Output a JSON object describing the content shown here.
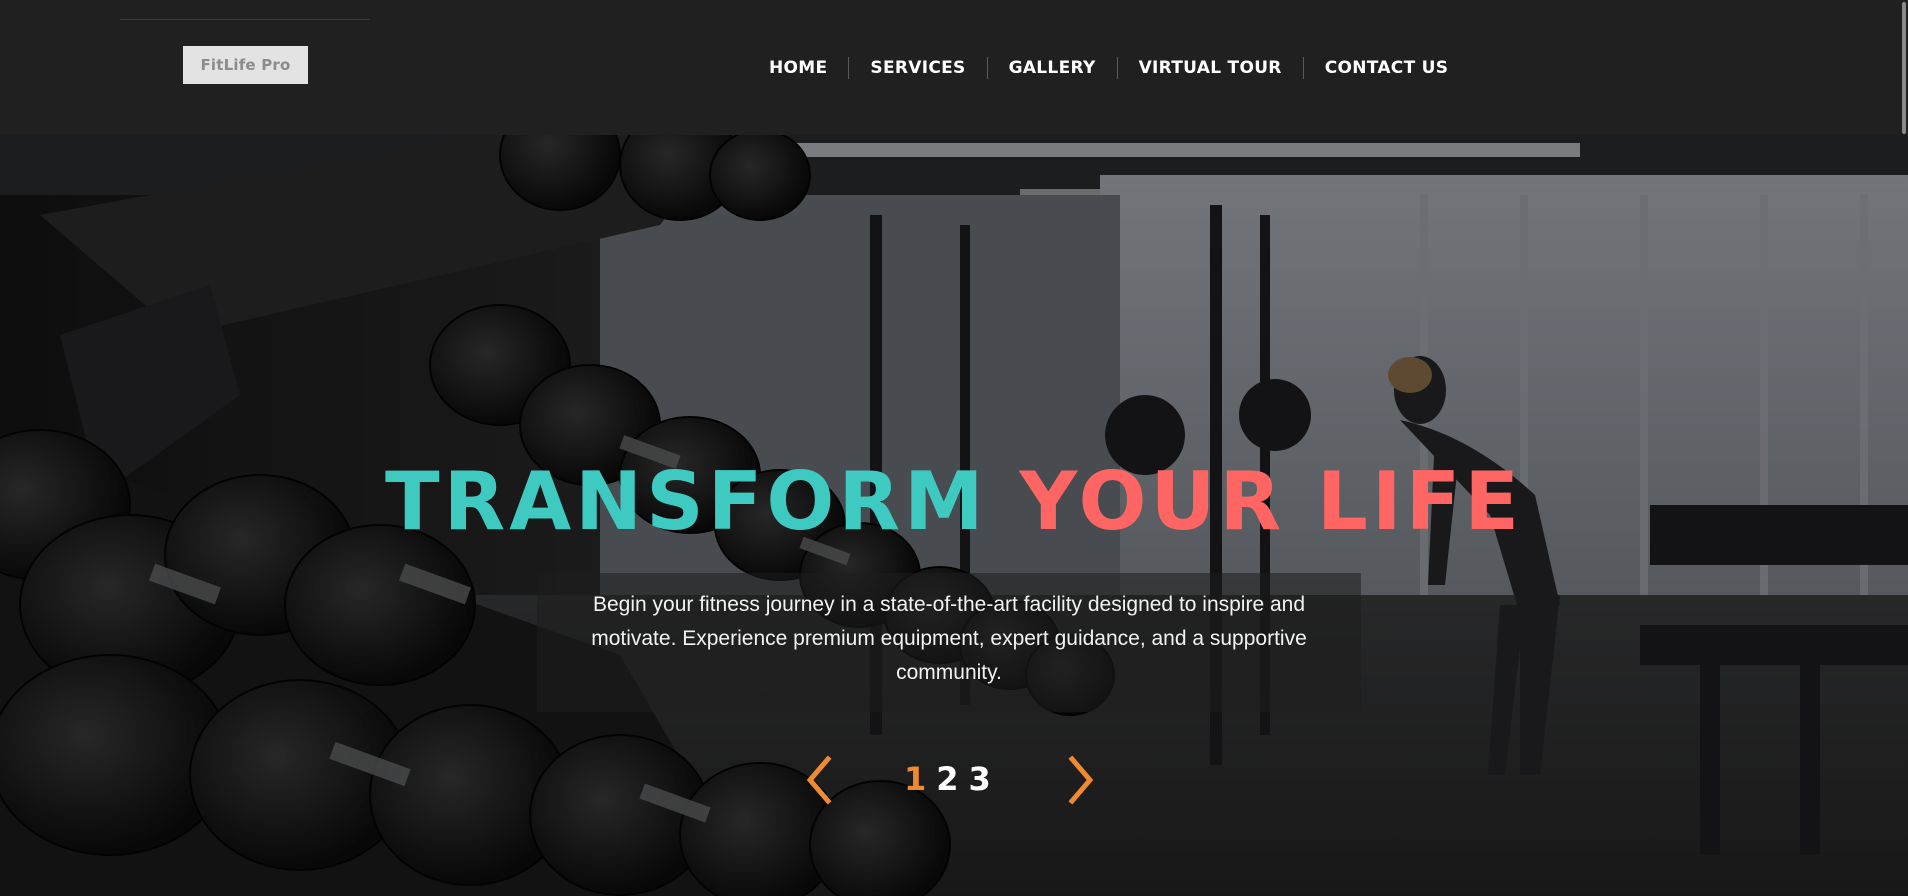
{
  "header": {
    "logo_text": "FitLife Pro",
    "nav": [
      {
        "label": "HOME"
      },
      {
        "label": "SERVICES"
      },
      {
        "label": "GALLERY"
      },
      {
        "label": "VIRTUAL TOUR"
      },
      {
        "label": "CONTACT US"
      }
    ]
  },
  "hero": {
    "title_part1": "TRANSFORM",
    "title_part2": "YOUR LIFE",
    "description": "Begin your fitness journey in a state-of-the-art facility designed to inspire and motivate. Experience premium equipment, expert guidance, and a supportive community.",
    "background_image": "gym-dumbbell-rack-photo",
    "slider": {
      "prev_icon": "chevron-left-icon",
      "next_icon": "chevron-right-icon",
      "pages": [
        "1",
        "2",
        "3"
      ],
      "active_page": "1"
    }
  },
  "colors": {
    "header_bg": "#202020",
    "title_teal": "#3ec9c1",
    "title_coral": "#ff6663",
    "accent_orange": "#f08a30"
  }
}
